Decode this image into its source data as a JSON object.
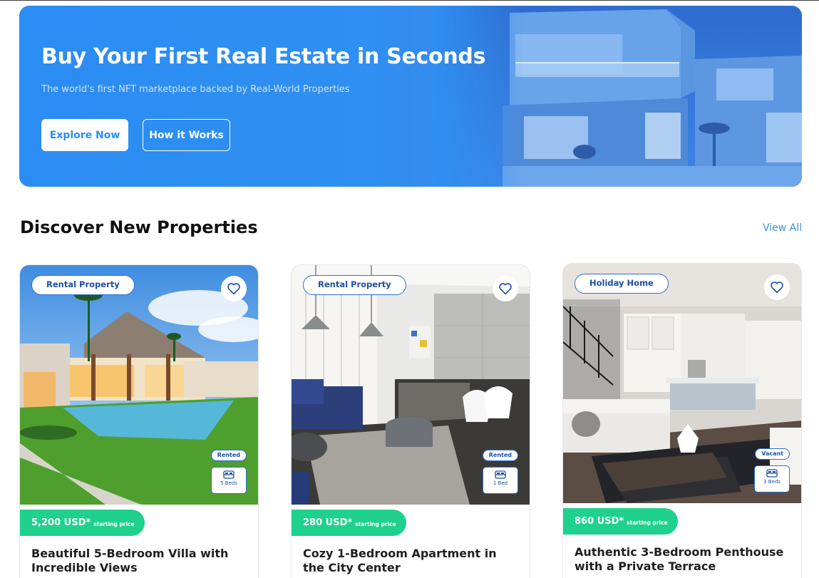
{
  "hero": {
    "title": "Buy Your First Real Estate in Seconds",
    "subtitle": "The world's first NFT marketplace backed by Real-World Properties",
    "explore_label": "Explore Now",
    "how_label": "How it Works"
  },
  "section": {
    "title": "Discover New Properties",
    "view_all": "View All"
  },
  "cards": [
    {
      "tag": "Rental Property",
      "status": "Rented",
      "beds": "5 Beds",
      "price": "5,200 USD*",
      "price_sub": "starting price",
      "title": "Beautiful 5-Bedroom Villa with Incredible Views"
    },
    {
      "tag": "Rental Property",
      "status": "Rented",
      "beds": "1 Bed",
      "price": "280 USD*",
      "price_sub": "starting price",
      "title": "Cozy 1-Bedroom Apartment in the City Center"
    },
    {
      "tag": "Holiday Home",
      "status": "Vacant",
      "beds": "3 Beds",
      "price": "860 USD*",
      "price_sub": "starting price",
      "title": "Authentic 3-Bedroom Penthouse with a Private Terrace"
    }
  ],
  "colors": {
    "primary": "#2b8cf3",
    "accent_green": "#1fd18d",
    "tag_border": "#2b6fd6",
    "link": "#3b8fe6"
  },
  "icons": [
    "heart-icon",
    "bed-icon"
  ]
}
